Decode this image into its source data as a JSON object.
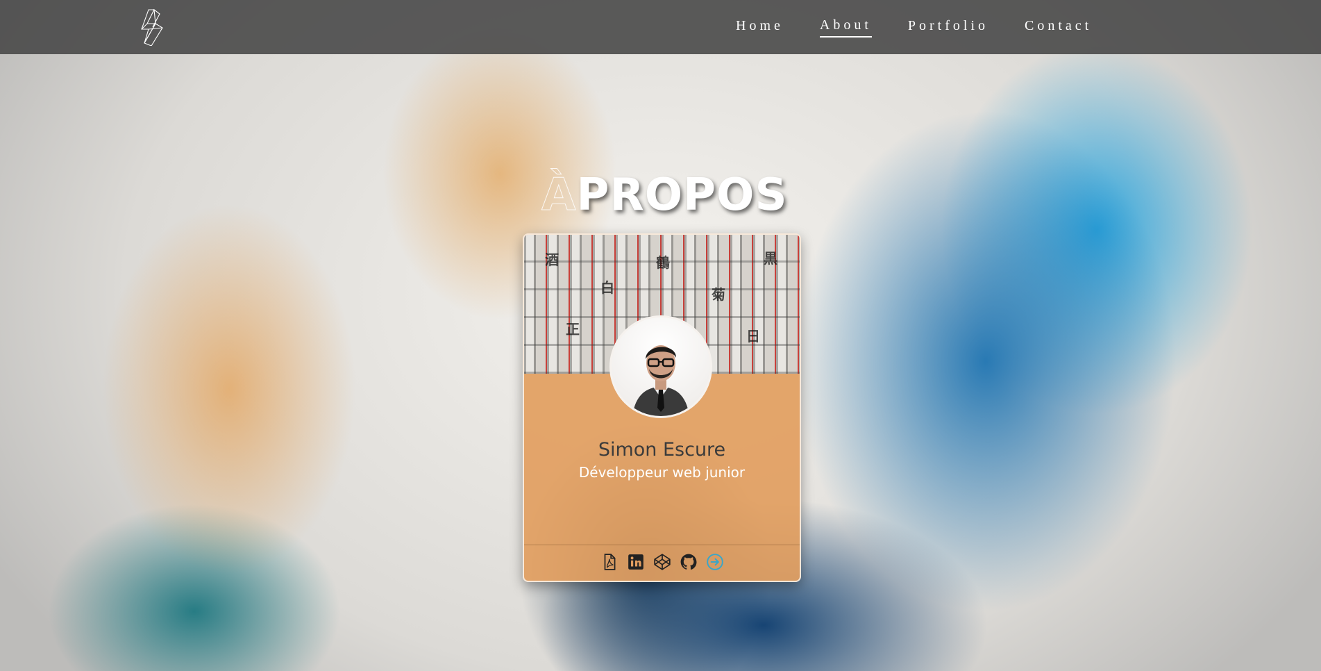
{
  "navbar": {
    "logo_icon": "bolt-cube-logo-icon",
    "items": [
      {
        "label": "Home",
        "active": false
      },
      {
        "label": "About",
        "active": true
      },
      {
        "label": "Portfolio",
        "active": false
      },
      {
        "label": "Contact",
        "active": false
      }
    ]
  },
  "section": {
    "title_accent": "À",
    "title": "PROPOS"
  },
  "card": {
    "name": "Simon Escure",
    "role": "Développeur web junior",
    "accent_color": "#e29e60",
    "social_icons": [
      "pdf-icon",
      "linkedin-icon",
      "codepen-icon",
      "github-icon",
      "arrow-right-circle-icon"
    ]
  }
}
